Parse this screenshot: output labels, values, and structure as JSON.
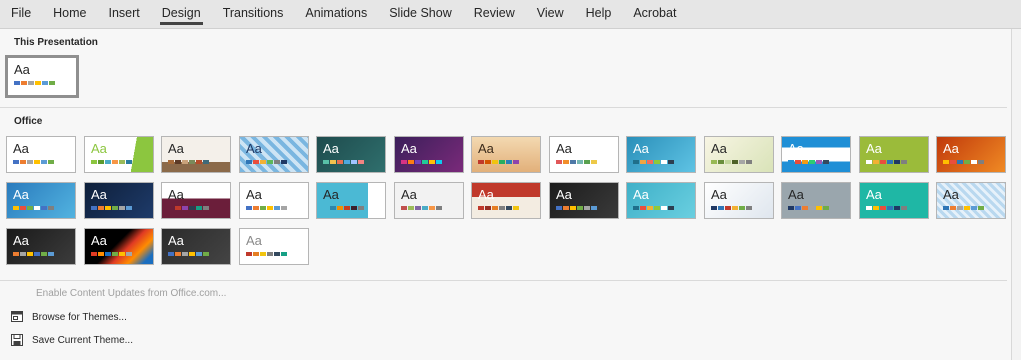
{
  "ribbon": {
    "tabs": [
      "File",
      "Home",
      "Insert",
      "Design",
      "Transitions",
      "Animations",
      "Slide Show",
      "Review",
      "View",
      "Help",
      "Acrobat"
    ],
    "active_tab": "Design"
  },
  "gallery": {
    "this_presentation_label": "This Presentation",
    "office_label": "Office",
    "sample_text": "Aa"
  },
  "themes": {
    "current": {
      "bg": "#ffffff",
      "fg": "#262626",
      "sw": [
        "#4472c4",
        "#ed7d31",
        "#a5a5a5",
        "#ffc000",
        "#5b9bd5",
        "#70ad47"
      ]
    },
    "office": [
      {
        "bg": "#ffffff",
        "fg": "#262626",
        "sw": [
          "#4472c4",
          "#ed7d31",
          "#a5a5a5",
          "#ffc000",
          "#5b9bd5",
          "#70ad47"
        ]
      },
      {
        "bg": "linear-gradient(100deg,#ffffff 70%,#8cc63f 70%)",
        "fg": "#8cc63f",
        "sw": [
          "#8cc63f",
          "#5c9a2e",
          "#4bacc6",
          "#f79646",
          "#9bbb59",
          "#2c7c9f"
        ]
      },
      {
        "bg": "linear-gradient(180deg,#f4f0ea 72%,#8b6a4a 72%)",
        "fg": "#262626",
        "sw": [
          "#a66b3a",
          "#5c3a26",
          "#c9a27a",
          "#7a8a5a",
          "#b54c2a",
          "#3f6a7a"
        ]
      },
      {
        "bg": "repeating-linear-gradient(45deg,#7ab6e0 0 4px,#cde4f4 4px 8px)",
        "fg": "#1f3864",
        "sw": [
          "#2e75b6",
          "#e94e3d",
          "#f2b134",
          "#5cb85c",
          "#7f7f7f",
          "#1f3864"
        ]
      },
      {
        "bg": "linear-gradient(135deg,#1e4b4d,#2f6f6d)",
        "fg": "#ffffff",
        "sw": [
          "#59c1a8",
          "#f2c14e",
          "#e76f51",
          "#4ea8de",
          "#a0c4ff",
          "#f28482"
        ]
      },
      {
        "bg": "linear-gradient(135deg,#3b1f5a,#7a2a7a)",
        "fg": "#ffffff",
        "sw": [
          "#d63384",
          "#fd7e14",
          "#6f42c1",
          "#20c997",
          "#ffc107",
          "#0dcaf0"
        ]
      },
      {
        "bg": "linear-gradient(180deg,#f3d9b1,#e2b07a)",
        "fg": "#3a2a1a",
        "sw": [
          "#c0392b",
          "#d35400",
          "#f1c40f",
          "#27ae60",
          "#2980b9",
          "#8e44ad"
        ]
      },
      {
        "bg": "#ffffff",
        "fg": "#262626",
        "sw": [
          "#e15759",
          "#f28e2b",
          "#4e79a7",
          "#76b7b2",
          "#59a14f",
          "#edc948"
        ]
      },
      {
        "bg": "linear-gradient(135deg,#2a8fb9,#5fc3e4)",
        "fg": "#ffffff",
        "sw": [
          "#1f6f8b",
          "#f2a541",
          "#f36c5c",
          "#8fc93a",
          "#ffffff",
          "#2c3e50"
        ]
      },
      {
        "bg": "linear-gradient(135deg,#f8f5e4,#d9e3b8)",
        "fg": "#262626",
        "sw": [
          "#98b954",
          "#6a8e3c",
          "#c3d69b",
          "#4f6228",
          "#a5a5a5",
          "#7f7f7f"
        ]
      },
      {
        "bg": "linear-gradient(180deg,#1f8fd6 0 30%,#ffffff 30% 70%,#1f8fd6 70%)",
        "fg": "#ffffff",
        "sw": [
          "#1f8fd6",
          "#e74c3c",
          "#f39c12",
          "#2ecc71",
          "#9b59b6",
          "#34495e"
        ]
      },
      {
        "bg": "#9bbb3a",
        "fg": "#ffffff",
        "sw": [
          "#ffffff",
          "#f2b134",
          "#e94e3d",
          "#2e75b6",
          "#1f3864",
          "#7f7f7f"
        ]
      },
      {
        "bg": "linear-gradient(135deg,#c0390b,#f08a24)",
        "fg": "#ffffff",
        "sw": [
          "#ffc000",
          "#e94e3d",
          "#2e75b6",
          "#70ad47",
          "#ffffff",
          "#7f7f7f"
        ]
      },
      {
        "bg": "linear-gradient(135deg,#2a7bbd,#52b3e0)",
        "fg": "#ffffff",
        "sw": [
          "#ffc000",
          "#e94e3d",
          "#70ad47",
          "#ffffff",
          "#4472c4",
          "#7f7f7f"
        ]
      },
      {
        "bg": "linear-gradient(135deg,#0e1f3a,#1e3b6a)",
        "fg": "#ffffff",
        "sw": [
          "#4472c4",
          "#ed7d31",
          "#ffc000",
          "#70ad47",
          "#a5a5a5",
          "#5b9bd5"
        ]
      },
      {
        "bg": "linear-gradient(180deg,#ffffff 45%,#6b1e3a 45%)",
        "fg": "#262626",
        "sw": [
          "#6b1e3a",
          "#c0392b",
          "#8e44ad",
          "#2c3e50",
          "#16a085",
          "#7f7f7f"
        ]
      },
      {
        "bg": "#ffffff",
        "fg": "#262626",
        "sw": [
          "#4472c4",
          "#ed7d31",
          "#70ad47",
          "#ffc000",
          "#5b9bd5",
          "#a5a5a5"
        ]
      },
      {
        "bg": "linear-gradient(90deg,#4bb9d4 75%,#ffffff 75%)",
        "fg": "#262626",
        "sw": [
          "#4bb9d4",
          "#2e86ab",
          "#f18f01",
          "#c73e1d",
          "#3b1f2b",
          "#7f7f7f"
        ]
      },
      {
        "bg": "#f2f2f2",
        "fg": "#262626",
        "sw": [
          "#c0504d",
          "#9bbb59",
          "#8064a2",
          "#4bacc6",
          "#f79646",
          "#7f7f7f"
        ]
      },
      {
        "bg": "linear-gradient(180deg,#c0392b 40%,#f3ece1 40%)",
        "fg": "#ffffff",
        "sw": [
          "#c0392b",
          "#962d22",
          "#e67e22",
          "#7f7f7f",
          "#34495e",
          "#f1c40f"
        ]
      },
      {
        "bg": "linear-gradient(135deg,#1c1c1c,#3a3a3a)",
        "fg": "#ffffff",
        "sw": [
          "#4472c4",
          "#ed7d31",
          "#ffc000",
          "#70ad47",
          "#a5a5a5",
          "#5b9bd5"
        ]
      },
      {
        "bg": "linear-gradient(135deg,#3fb0c8,#6acfe0)",
        "fg": "#ffffff",
        "sw": [
          "#1f6f8b",
          "#e94e3d",
          "#f2b134",
          "#8fc93a",
          "#ffffff",
          "#2c3e50"
        ]
      },
      {
        "bg": "linear-gradient(135deg,#ffffff,#dfe6ee)",
        "fg": "#262626",
        "sw": [
          "#1f3864",
          "#2e75b6",
          "#c0392b",
          "#f2b134",
          "#70ad47",
          "#7f7f7f"
        ]
      },
      {
        "bg": "#9aa6ad",
        "fg": "#262626",
        "sw": [
          "#1f3864",
          "#4472c4",
          "#ed7d31",
          "#a5a5a5",
          "#ffc000",
          "#70ad47"
        ]
      },
      {
        "bg": "#1fb7a5",
        "fg": "#ffffff",
        "sw": [
          "#ffffff",
          "#ffc000",
          "#e94e3d",
          "#2e75b6",
          "#1f3864",
          "#7f7f7f"
        ]
      },
      {
        "bg": "repeating-linear-gradient(45deg,#b9d8ef 0 3px,#e6f1fa 3px 6px)",
        "fg": "#262626",
        "sw": [
          "#2e75b6",
          "#ed7d31",
          "#a5a5a5",
          "#ffc000",
          "#5b9bd5",
          "#70ad47"
        ]
      },
      {
        "bg": "linear-gradient(135deg,#1a1a1a,#3c3c3c)",
        "fg": "#ffffff",
        "sw": [
          "#ed7d31",
          "#a5a5a5",
          "#ffc000",
          "#4472c4",
          "#70ad47",
          "#5b9bd5"
        ]
      },
      {
        "bg": "linear-gradient(135deg,#000000 45%,#e03b24 60%,#ff8c00 75%,#1a6ec0 90%)",
        "fg": "#ffffff",
        "sw": [
          "#e03b24",
          "#ff8c00",
          "#1a6ec0",
          "#70ad47",
          "#ffc000",
          "#a5a5a5"
        ]
      },
      {
        "bg": "linear-gradient(135deg,#2b2b2b,#444444)",
        "fg": "#ffffff",
        "sw": [
          "#4472c4",
          "#ed7d31",
          "#a5a5a5",
          "#ffc000",
          "#5b9bd5",
          "#70ad47"
        ]
      },
      {
        "bg": "#ffffff",
        "fg": "#8a8a8a",
        "sw": [
          "#c0392b",
          "#e67e22",
          "#f1c40f",
          "#7f7f7f",
          "#34495e",
          "#16a085"
        ]
      }
    ]
  },
  "menu": {
    "enable_updates": "Enable Content Updates from Office.com...",
    "browse_themes": "Browse for Themes...",
    "save_theme": "Save Current Theme..."
  }
}
